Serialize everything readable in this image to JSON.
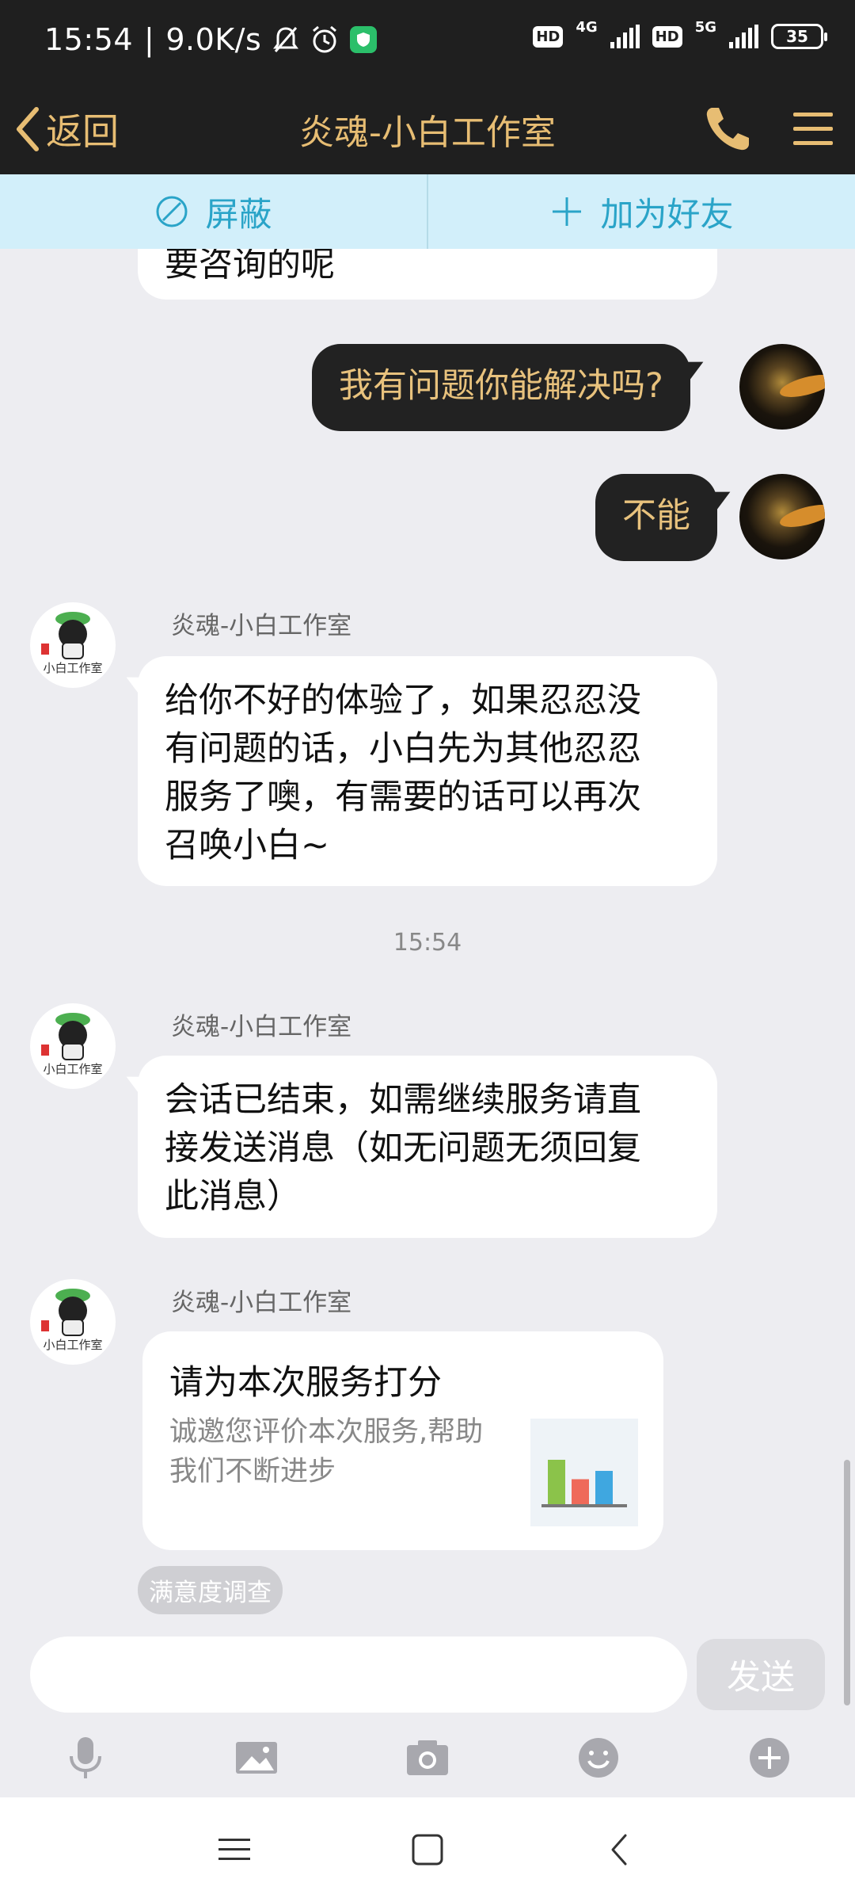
{
  "status_bar": {
    "time": "15:54",
    "speed": "9.0K/s",
    "network_1": "4G",
    "network_2": "5G",
    "hd_label": "HD",
    "battery": "35"
  },
  "header": {
    "back_label": "返回",
    "title": "炎魂-小白工作室"
  },
  "actions": {
    "block_label": "屏蔽",
    "add_friend_label": "加为好友"
  },
  "messages": {
    "m0_text": "要咨询的呢",
    "m1_text": "我有问题你能解决吗?",
    "m2_text": "不能",
    "m3_sender": "炎魂-小白工作室",
    "m3_lines": [
      "给你不好的体验了，如果忍忍没",
      "有问题的话，小白先为其他忍忍",
      "服务了噢，有需要的话可以再次",
      "召唤小白~"
    ],
    "time_divider": "15:54",
    "m4_sender": "炎魂-小白工作室",
    "m4_lines": [
      "会话已结束，如需继续服务请直",
      "接发送消息（如无问题无须回复",
      "此消息）"
    ],
    "m5_sender": "炎魂-小白工作室",
    "card_title": "请为本次服务打分",
    "card_desc_lines": [
      "诚邀您评价本次服务,帮助",
      "我们不断进步"
    ],
    "survey_tag": "满意度调查",
    "bot_avatar_text": "小白工作室"
  },
  "chart_icon": {
    "bars": [
      0.8,
      0.45,
      0.6
    ],
    "colors": [
      "#8bc34a",
      "#ef6a5a",
      "#3fa7e0"
    ]
  },
  "input": {
    "placeholder": "",
    "send_label": "发送"
  },
  "colors": {
    "accent_gold": "#e7bd73",
    "action_blue": "#2aa4c8",
    "dark_bar": "#1f1f1f"
  },
  "icons": [
    "mic-icon",
    "image-icon",
    "camera-icon",
    "emoji-icon",
    "plus-icon"
  ]
}
